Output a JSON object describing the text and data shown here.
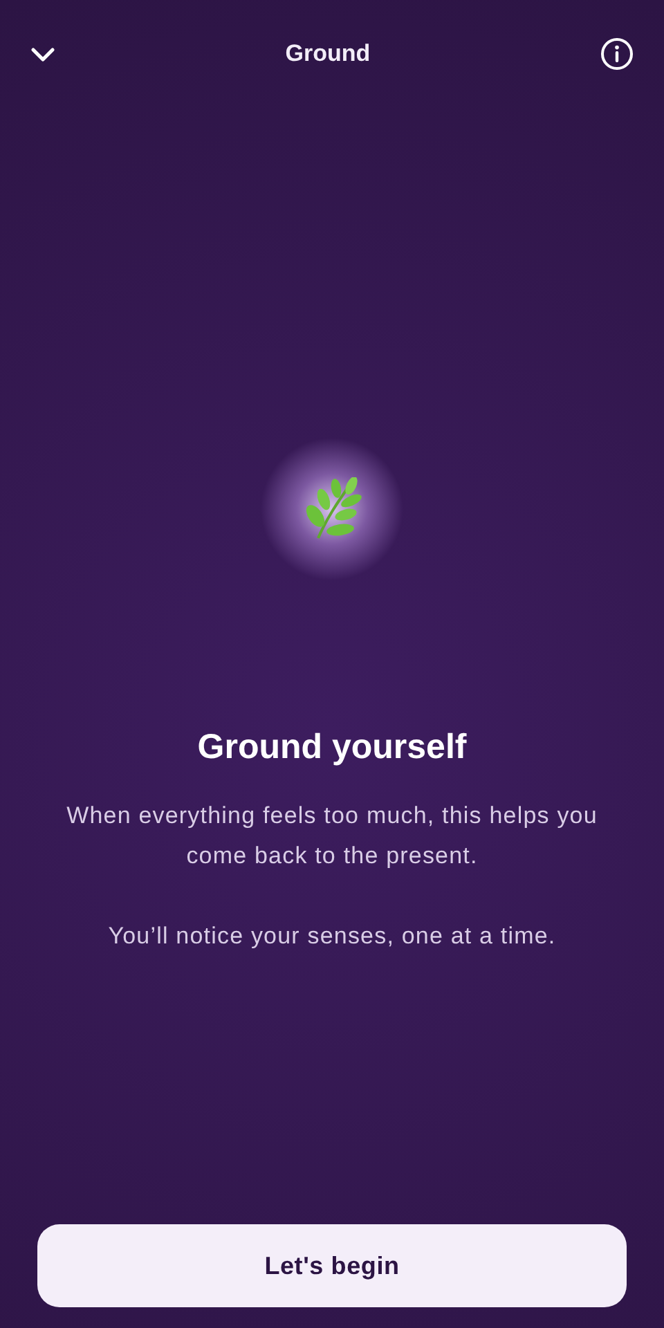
{
  "header": {
    "title": "Ground"
  },
  "hero": {
    "title": "Ground yourself",
    "body": "When everything feels too much, this helps you\ncome back to the present.",
    "note": "You’ll notice your senses, one at a time."
  },
  "button": {
    "label": "Let's begin"
  }
}
